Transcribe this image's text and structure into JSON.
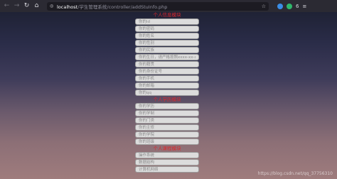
{
  "browser": {
    "url_host": "localhost",
    "url_path": "/学生管理系统/controller/addStuInfo.php",
    "ext_label": "6"
  },
  "sections": [
    {
      "title": "个人信息模块",
      "fields": [
        "你的id",
        "你的密码",
        "你的姓名",
        "你的性别",
        "你的民族",
        "你的生日，请严格按照xxxx-xx-xx",
        "你的籍贯",
        "你的身份证号",
        "你的手机",
        "你的邮箱",
        "你的qq"
      ]
    },
    {
      "title": "个人学历模块",
      "fields": [
        "你的学历",
        "你的学制",
        "你的门类",
        "你的主修",
        "你的学院",
        "你的班级"
      ]
    },
    {
      "title": "个人课程模块",
      "fields": [
        "操作系统",
        "数据结构",
        "计算机网络"
      ]
    }
  ],
  "watermark": "https://blog.csdn.net/qq_37756310"
}
